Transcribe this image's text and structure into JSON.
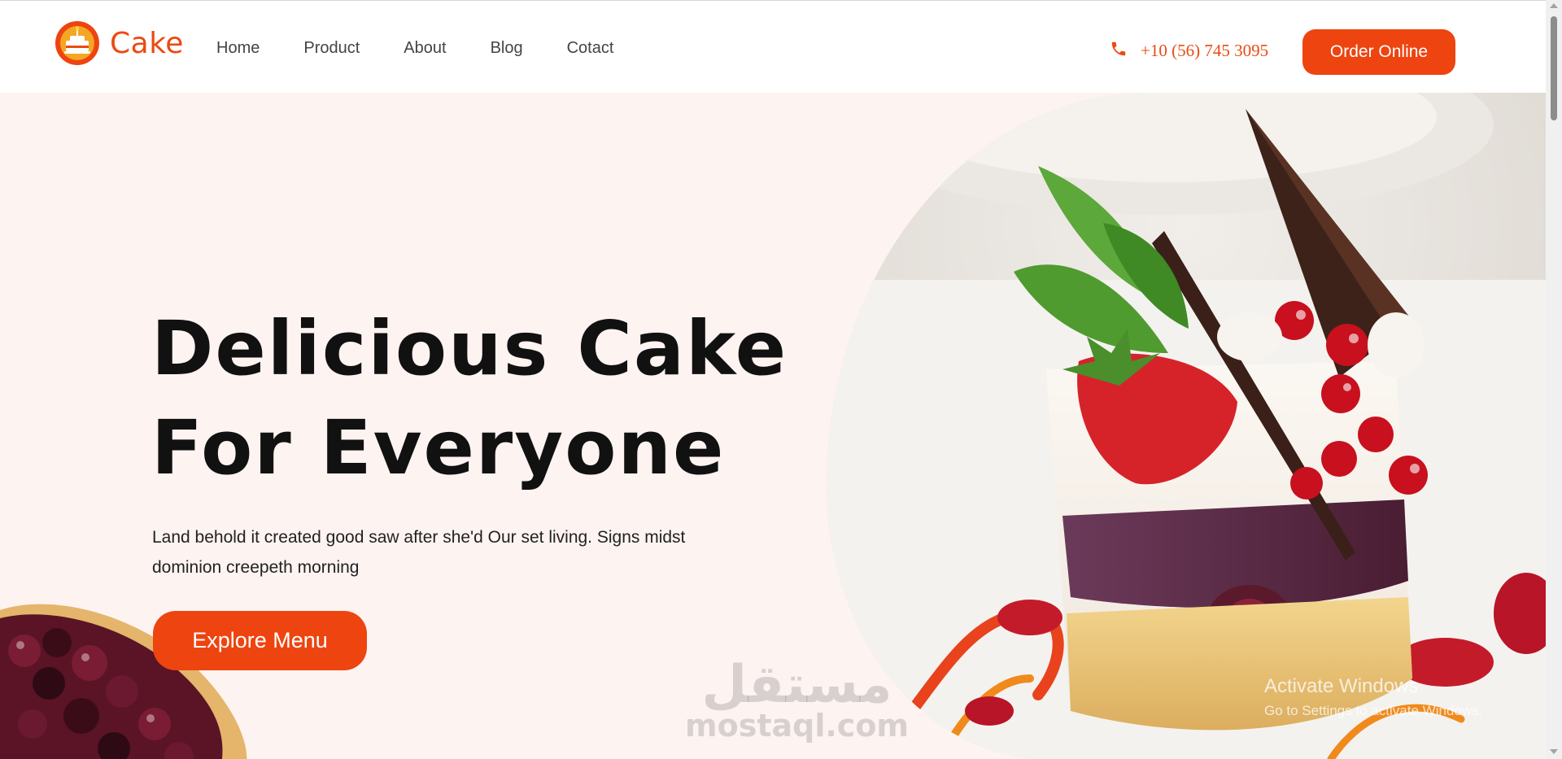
{
  "brand": {
    "name": "Cake",
    "accent": "#ee4410",
    "logo_icon": "cake-logo-icon"
  },
  "nav": {
    "items": [
      "Home",
      "Product",
      "About",
      "Blog",
      "Cotact"
    ]
  },
  "contact": {
    "phone": "+10 (56) 745 3095",
    "icon": "phone-icon"
  },
  "header": {
    "order_label": "Order Online"
  },
  "hero": {
    "title_line1": "Delicious Cake",
    "title_line2": "For Everyone",
    "description": "Land behold it created good saw after she'd Our set living. Signs midst dominion creepeth morning",
    "cta_label": "Explore Menu",
    "background": "#fdf3f1"
  },
  "watermark": {
    "arabic": "مستقل",
    "latin": "mostaql.com"
  },
  "os_overlay": {
    "title": "Activate Windows",
    "subtitle": "Go to Settings to activate Windows."
  }
}
